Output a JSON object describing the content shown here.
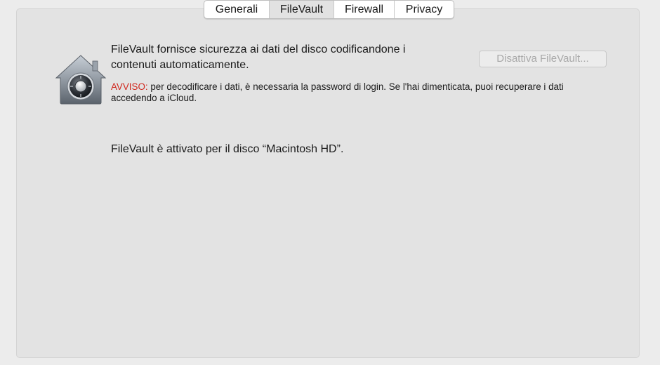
{
  "tabs": [
    {
      "label": "Generali"
    },
    {
      "label": "FileVault"
    },
    {
      "label": "Firewall"
    },
    {
      "label": "Privacy"
    }
  ],
  "selected_tab": "FileVault",
  "filevault": {
    "icon": "filevault-house-lock-icon",
    "description": "FileVault fornisce sicurezza ai dati del disco codificandone i contenuti automaticamente.",
    "warning_label": "AVVISO:",
    "warning_text": " per decodificare i dati, è necessaria la password di login. Se l'hai dimenticata, puoi recuperare i dati accedendo a iCloud.",
    "button_label": "Disattiva FileVault...",
    "status": "FileVault è attivato per il disco “Macintosh HD”."
  },
  "colors": {
    "warning": "#d0281f",
    "button_disabled_text": "#a9a9a9",
    "panel_background": "#e3e3e3"
  }
}
